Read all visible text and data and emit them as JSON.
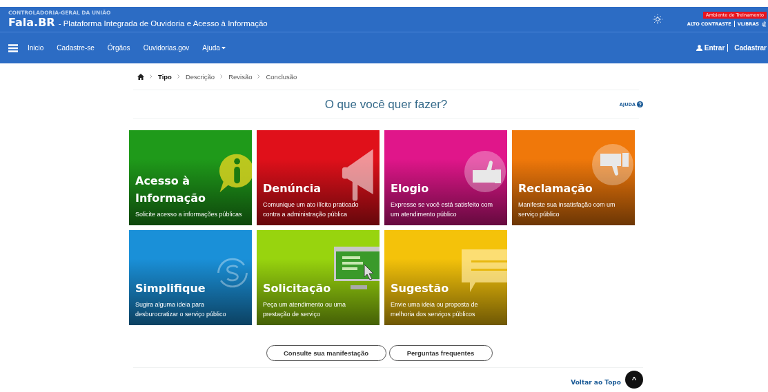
{
  "header": {
    "agency": "CONTROLADORIA-GERAL DA UNIÃO",
    "brand": "Fala.BR",
    "subtitle": "- Plataforma Integrada de Ouvidoria e Acesso à Informação",
    "env_badge": "Ambiente de Treinamento",
    "contrast_link": "ALTO CONTRASTE",
    "libras_link": "VLIBRAS"
  },
  "nav": {
    "items": [
      "Inicio",
      "Cadastre-se",
      "Órgãos",
      "Ouvidorias.gov",
      "Ajuda"
    ],
    "login": "Entrar",
    "register": "Cadastrar"
  },
  "breadcrumb": [
    {
      "label": "Tipo",
      "selected": true
    },
    {
      "label": "Descrição",
      "selected": false
    },
    {
      "label": "Revisão",
      "selected": false
    },
    {
      "label": "Conclusão",
      "selected": false
    }
  ],
  "heading": "O que você quer fazer?",
  "help_link": "AJUDA",
  "cards": [
    {
      "title": "Acesso à Informação",
      "description": "Solicite acesso a informações públicas",
      "color": "#1f9a1a",
      "kind": "info"
    },
    {
      "title": "Denúncia",
      "description": "Comunique um ato ilícito praticado contra a administração pública",
      "color": "#e0101a",
      "kind": "megaphone"
    },
    {
      "title": "Elogio",
      "description": "Expresse se você está satisfeito com um atendimento público",
      "color": "#e0168a",
      "kind": "thumbs-up"
    },
    {
      "title": "Reclamação",
      "description": "Manifeste sua insatisfação com um serviço público",
      "color": "#f0780a",
      "kind": "thumbs-down"
    },
    {
      "title": "Simplifique",
      "description": "Sugira alguma ideia para desburocratizar o serviço público",
      "color": "#1a90d8",
      "kind": "sync"
    },
    {
      "title": "Solicitação",
      "description": "Peça um atendimento ou uma prestação de serviço",
      "color": "#98d40e",
      "kind": "monitor"
    },
    {
      "title": "Sugestão",
      "description": "Envie uma ideia ou proposta de melhoria dos serviços públicos",
      "color": "#f4c20a",
      "kind": "speech"
    }
  ],
  "buttons": [
    "Consulte sua manifestação",
    "Perguntas frequentes"
  ],
  "back_to_top": {
    "label": "Voltar ao Topo",
    "symbol": "^"
  }
}
